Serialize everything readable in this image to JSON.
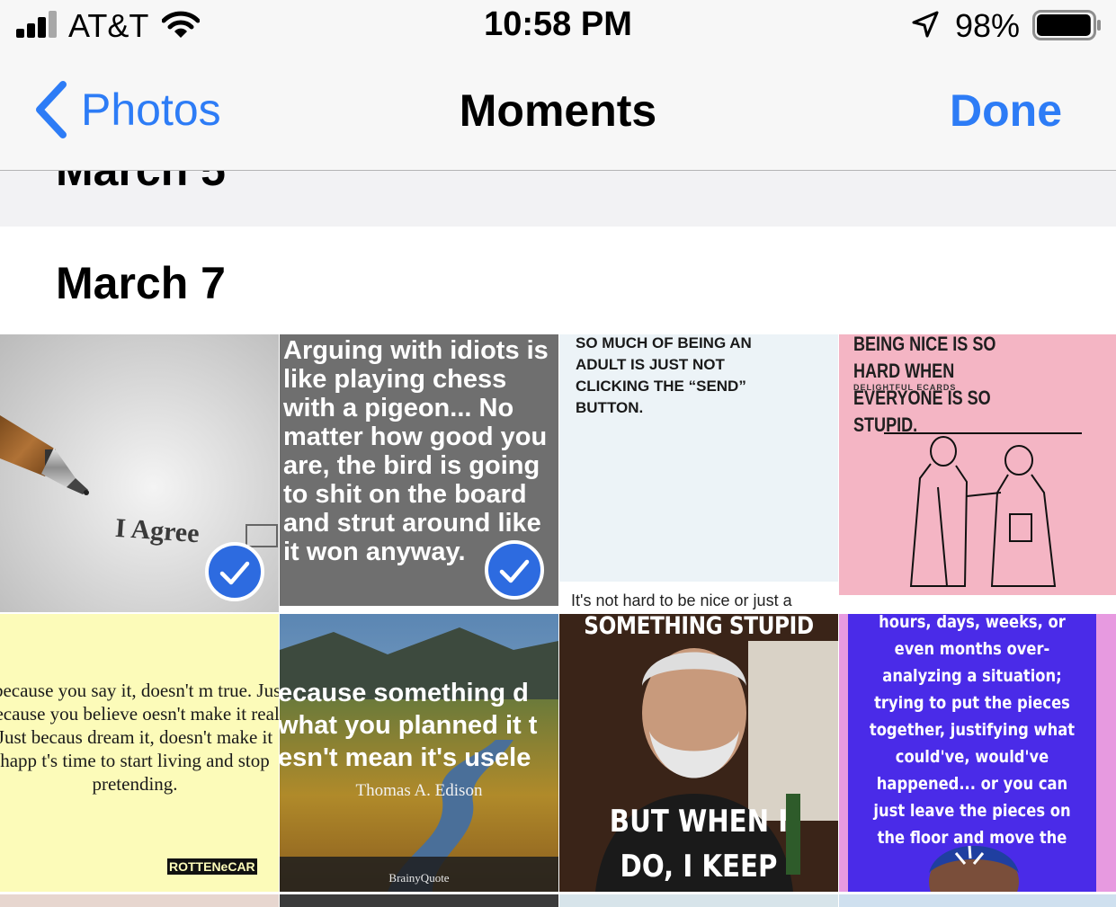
{
  "status_bar": {
    "carrier": "AT&T",
    "time": "10:58 PM",
    "battery_percent": "98%",
    "battery_level": 0.98,
    "icons": [
      "cellular-signal-icon",
      "wifi-icon",
      "location-arrow-icon",
      "battery-icon"
    ]
  },
  "nav": {
    "back_label": "Photos",
    "title": "Moments",
    "done_label": "Done",
    "accent_color": "#2d7cf6"
  },
  "sections": {
    "previous_title": "March 5",
    "current_title": "March 7"
  },
  "tiles": [
    {
      "selected": true,
      "text": "I Agree"
    },
    {
      "selected": true,
      "text": "Arguing with idiots is like playing chess with a pigeon... No matter how good you are, the bird is going to shit on the board and strut around like it won anyway."
    },
    {
      "selected": false,
      "text": "SO MUCH OF BEING AN ADULT IS JUST NOT CLICKING THE “SEND” BUTTON.",
      "caption": "It's not hard to be nice or just a"
    },
    {
      "selected": false,
      "text": "BEING NICE IS SO HARD WHEN EVERYONE IS SO STUPID.",
      "brand": "DELIGHTFUL ECARDS"
    },
    {
      "selected": false,
      "text": "t because you say it, doesn't m true. Just because you believe oesn't make it real. Just becaus dream it, doesn't make it happ t's time to start living and stop pretending.",
      "brand": "ROTTENeCAR"
    },
    {
      "selected": false,
      "text": "ecause something d what you planned it t esn't mean it's usele",
      "author": "Thomas A. Edison",
      "brand": "BrainyQuote"
    },
    {
      "selected": false,
      "text_top": "SOMETHING STUPID",
      "text_bottom": "BUT WHEN I DO, I KEEP TALKING TO"
    },
    {
      "selected": false,
      "text": "hours, days, weeks, or even months over-analyzing a situation; trying to put the pieces together, justifying what could've, would've happened... or you can just leave the pieces on the floor and move the fcku on."
    }
  ]
}
